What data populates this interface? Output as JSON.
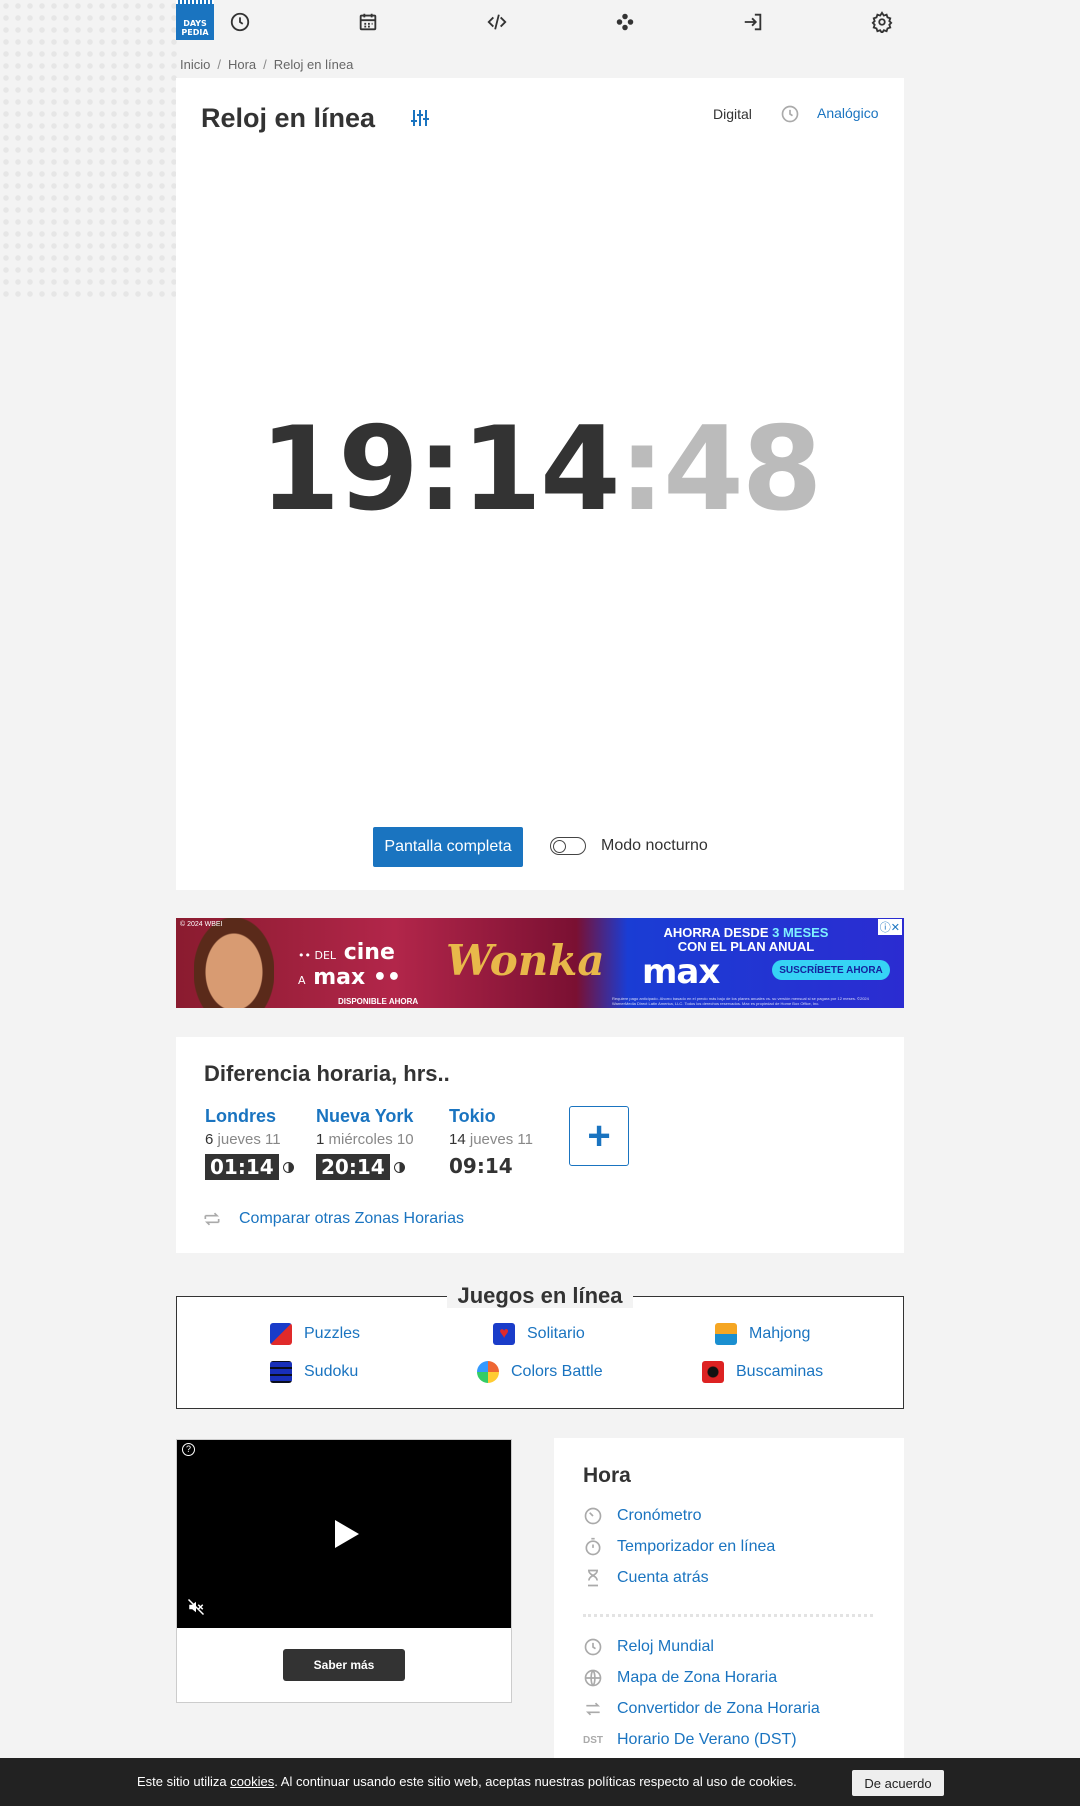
{
  "brand": {
    "logo_line1": "DAYS",
    "logo_line2": "PEDIA"
  },
  "nav": {
    "icons": [
      "clock-icon",
      "calendar-icon",
      "code-icon",
      "games-icon",
      "login-icon",
      "settings-icon"
    ]
  },
  "breadcrumb": {
    "items": [
      "Inicio",
      "Hora",
      "Reloj en línea"
    ],
    "separator": "/"
  },
  "clock": {
    "title": "Reloj en línea",
    "mode_digital": "Digital",
    "mode_analog": "Analógico",
    "hours_minutes": "19:14",
    "seconds": ":48",
    "fullscreen_label": "Pantalla completa",
    "night_mode_label": "Modo nocturno",
    "night_mode_on": false
  },
  "ad": {
    "copyright": "© 2024 WBEI",
    "cine_prefix": "•• DEL",
    "cine_word": "cine",
    "cine_a": "A",
    "cine_max": "max ••",
    "available": "DISPONIBLE AHORA",
    "movie_title": "Wonka",
    "offer_line1_a": "AHORRA DESDE",
    "offer_line1_b": "3 MESES",
    "offer_line2": "CON EL PLAN ANUAL",
    "max_logo": "max",
    "cta": "SUSCRÍBETE AHORA",
    "legal": "Requiere pago anticipado. Ahorro basado en el precio más bajo de los planes anuales vs. su versión mensual si se pagara por 12 meses. ©2024 WarnerMedia Direct Latin America, LLC. Todos los derechos reservados. Max es propiedad de Home Box Office, Inc."
  },
  "time_difference": {
    "title": "Diferencia horaria, hrs..",
    "cities": [
      {
        "name": "Londres",
        "offset": "6",
        "day": "jueves 11",
        "time": "01:14",
        "night": true
      },
      {
        "name": "Nueva York",
        "offset": "1",
        "day": "miércoles 10",
        "time": "20:14",
        "night": true
      },
      {
        "name": "Tokio",
        "offset": "14",
        "day": "jueves 11",
        "time": "09:14",
        "night": false
      }
    ],
    "add_label": "+",
    "compare_link": "Comparar otras Zonas Horarias"
  },
  "games": {
    "title": "Juegos en línea",
    "items": [
      "Puzzles",
      "Solitario",
      "Mahjong",
      "Sudoku",
      "Colors Battle",
      "Buscaminas"
    ]
  },
  "video_ad": {
    "help": "?",
    "cta": "Saber más"
  },
  "sidebar": {
    "title": "Hora",
    "group1": [
      "Cronómetro",
      "Temporizador en línea",
      "Cuenta atrás"
    ],
    "group2": [
      "Reloj Mundial",
      "Mapa de Zona Horaria",
      "Convertidor de Zona Horaria",
      "Horario De Verano (DST)"
    ],
    "dst_badge": "DST"
  },
  "cookies": {
    "text_before": "Este sitio utiliza ",
    "link": "cookies",
    "text_after": ". Al continuar usando este sitio web, aceptas nuestras políticas respecto al uso de cookies.",
    "accept": "De acuerdo"
  },
  "colors": {
    "accent": "#1a74c0",
    "text": "#333333",
    "background": "#f3f3f3"
  }
}
